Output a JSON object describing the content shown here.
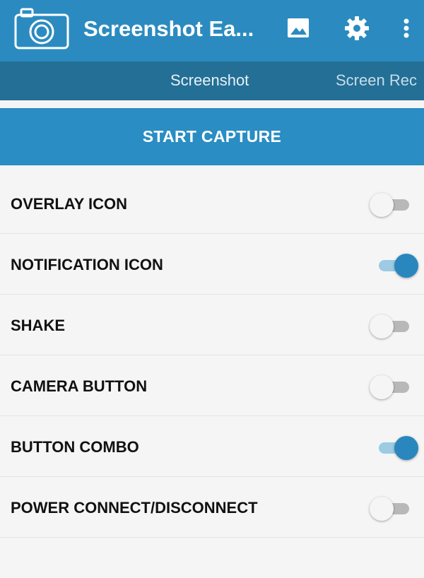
{
  "app_bar": {
    "title": "Screenshot Ea...",
    "logo_icon": "camera-icon",
    "actions": [
      "gallery-icon",
      "settings-icon",
      "more-options-icon"
    ]
  },
  "tabs": [
    {
      "label": "Screenshot",
      "selected": true
    },
    {
      "label": "Screen Rec",
      "selected": false
    }
  ],
  "start_capture": {
    "label": "START CAPTURE"
  },
  "settings": [
    {
      "label": "OVERLAY ICON",
      "enabled": false
    },
    {
      "label": "NOTIFICATION ICON",
      "enabled": true
    },
    {
      "label": "SHAKE",
      "enabled": false
    },
    {
      "label": "CAMERA BUTTON",
      "enabled": false
    },
    {
      "label": "BUTTON COMBO",
      "enabled": true
    },
    {
      "label": "POWER CONNECT/DISCONNECT",
      "enabled": false
    }
  ],
  "colors": {
    "app_bar": "#2b8bc0",
    "tab_bar": "#236f96",
    "accent": "#2a87be",
    "background": "#f5f5f5"
  }
}
